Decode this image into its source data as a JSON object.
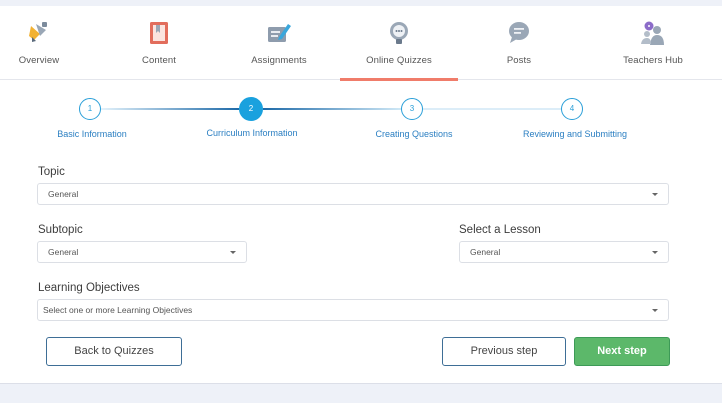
{
  "nav": {
    "items": [
      {
        "label": "Overview",
        "icon": "overview-icon",
        "active": false
      },
      {
        "label": "Content",
        "icon": "content-icon",
        "active": false
      },
      {
        "label": "Assignments",
        "icon": "assignments-icon",
        "active": false
      },
      {
        "label": "Online Quizzes",
        "icon": "online-quizzes-icon",
        "active": true
      },
      {
        "label": "Posts",
        "icon": "posts-icon",
        "active": false
      },
      {
        "label": "Teachers Hub",
        "icon": "teachers-hub-icon",
        "active": false
      }
    ],
    "accent_color": "#f07c6a"
  },
  "stepper": {
    "steps": [
      {
        "number": "1",
        "label": "Basic Information",
        "state": "done"
      },
      {
        "number": "2",
        "label": "Curriculum Information",
        "state": "active"
      },
      {
        "number": "3",
        "label": "Creating Questions",
        "state": "pending"
      },
      {
        "number": "4",
        "label": "Reviewing and Submitting",
        "state": "pending"
      }
    ],
    "active_color": "#1aa1de"
  },
  "form": {
    "topic": {
      "label": "Topic",
      "value": "General"
    },
    "subtopic": {
      "label": "Subtopic",
      "value": "General"
    },
    "lesson": {
      "label": "Select a Lesson",
      "value": "General"
    },
    "objectives": {
      "label": "Learning Objectives",
      "placeholder": "Select one or more Learning Objectives"
    }
  },
  "actions": {
    "back_label": "Back to Quizzes",
    "previous_label": "Previous step",
    "next_label": "Next step",
    "next_color": "#5cb86a"
  }
}
